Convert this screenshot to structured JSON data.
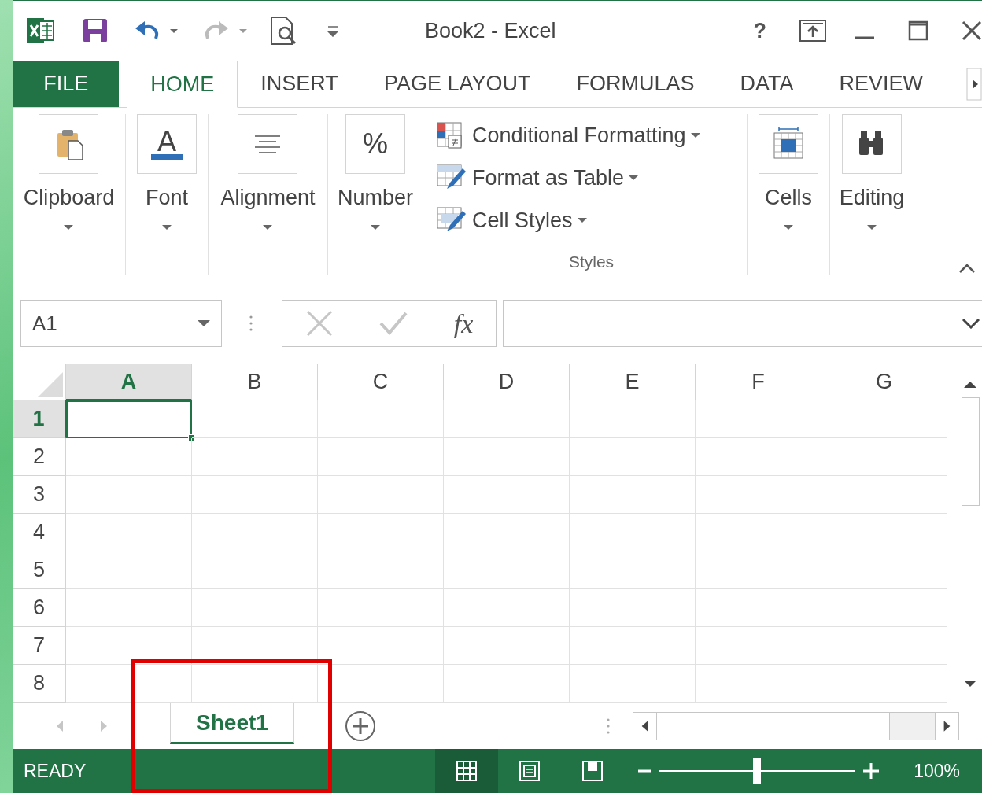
{
  "title_bar": {
    "title": "Book2 - Excel",
    "help": "?"
  },
  "quick_access": {
    "undo_enabled": true,
    "redo_enabled": false
  },
  "tabs": [
    {
      "label": "FILE",
      "kind": "file",
      "selected": false
    },
    {
      "label": "HOME",
      "kind": "tab",
      "selected": true
    },
    {
      "label": "INSERT",
      "kind": "tab",
      "selected": false
    },
    {
      "label": "PAGE LAYOUT",
      "kind": "tab",
      "selected": false
    },
    {
      "label": "FORMULAS",
      "kind": "tab",
      "selected": false
    },
    {
      "label": "DATA",
      "kind": "tab",
      "selected": false
    },
    {
      "label": "REVIEW",
      "kind": "tab",
      "selected": false
    }
  ],
  "ribbon": {
    "groups": [
      {
        "label": "Clipboard",
        "kind": "clipboard"
      },
      {
        "label": "Font",
        "kind": "font",
        "glyph": "A"
      },
      {
        "label": "Alignment",
        "kind": "alignment"
      },
      {
        "label": "Number",
        "kind": "number",
        "glyph": "%"
      },
      {
        "label": "Styles",
        "kind": "styles",
        "items": [
          {
            "label": "Conditional Formatting",
            "kind": "conditional"
          },
          {
            "label": "Format as Table",
            "kind": "table"
          },
          {
            "label": "Cell Styles",
            "kind": "cellstyles"
          }
        ]
      },
      {
        "label": "Cells",
        "kind": "cells"
      },
      {
        "label": "Editing",
        "kind": "editing"
      }
    ]
  },
  "formula_bar": {
    "name_box": "A1",
    "function_label": "fx"
  },
  "sheet": {
    "columns": [
      {
        "label": "A",
        "selected": true
      },
      {
        "label": "B",
        "selected": false
      },
      {
        "label": "C",
        "selected": false
      },
      {
        "label": "D",
        "selected": false
      },
      {
        "label": "E",
        "selected": false
      },
      {
        "label": "F",
        "selected": false
      },
      {
        "label": "G",
        "selected": false
      }
    ],
    "rows": [
      {
        "label": "1",
        "selected": true
      },
      {
        "label": "2",
        "selected": false
      },
      {
        "label": "3",
        "selected": false
      },
      {
        "label": "4",
        "selected": false
      },
      {
        "label": "5",
        "selected": false
      },
      {
        "label": "6",
        "selected": false
      },
      {
        "label": "7",
        "selected": false
      },
      {
        "label": "8",
        "selected": false
      }
    ]
  },
  "sheet_tabs": [
    {
      "label": "Sheet1",
      "selected": true
    }
  ],
  "status_bar": {
    "status": "READY",
    "views": [
      {
        "kind": "normal",
        "selected": true
      },
      {
        "kind": "page-layout",
        "selected": false
      },
      {
        "kind": "page-break",
        "selected": false
      }
    ],
    "zoom": {
      "level": 0.5,
      "reading": "100%"
    }
  },
  "highlight_box": {
    "shown": true
  }
}
